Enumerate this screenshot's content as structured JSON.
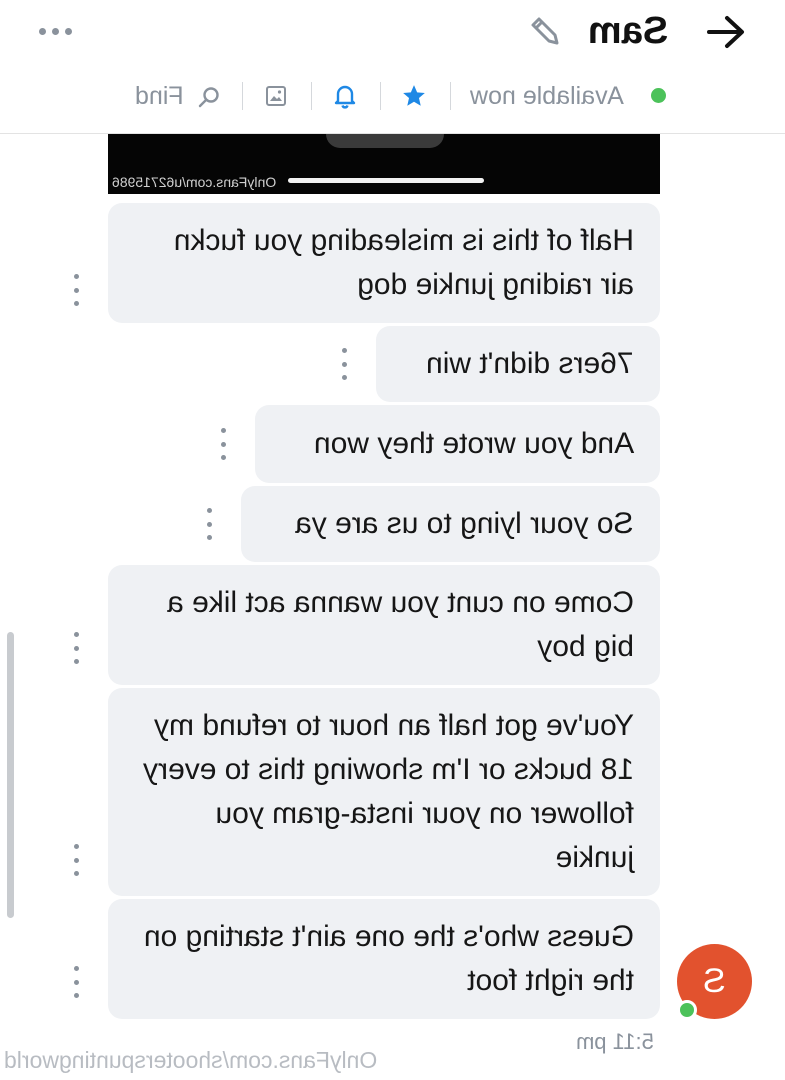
{
  "header": {
    "title": "Sam",
    "back_icon": "arrow-right-icon",
    "edit_icon": "pencil-icon",
    "more_icon": "more-horizontal-icon"
  },
  "subbar": {
    "status": "Available now",
    "status_color": "#4cc25a",
    "find_label": "Find",
    "icons": [
      "star-icon",
      "bell-icon",
      "image-icon",
      "search-icon"
    ]
  },
  "media": {
    "watermark": "OnlyFans.com/u62715986"
  },
  "messages": [
    "Half of this is misleading you fuckn air raiding junkie dog",
    "76ers didn't win",
    "And you wrote they won",
    "So your lying to us are ya",
    "Come on cunt you wanna act like a big boy",
    "You've got half an hour to refund my 18 bucks or I'm showing this to every follower on your insta-gram you junkie",
    "Guess who's the one ain't starting on the right foot"
  ],
  "avatar": {
    "initial": "S",
    "color": "#e2522e"
  },
  "timestamp": "5:11 pm",
  "watermark": "OnlyFans.com/shooterspuntingworld",
  "colors": {
    "bubble": "#eff1f4",
    "accent": "#1e88e5",
    "muted": "#8a929c"
  }
}
